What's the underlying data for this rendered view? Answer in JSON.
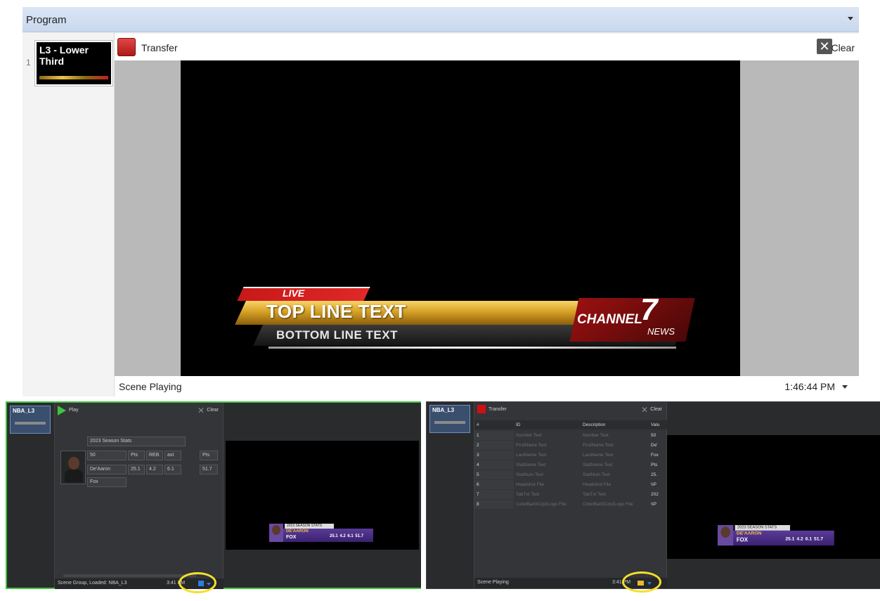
{
  "program": {
    "title": "Program",
    "scene_index": "1",
    "scene_thumb_label": "L3 - Lower Third",
    "transfer_label": "Transfer",
    "clear_label": "Clear",
    "status": "Scene Playing",
    "time": "1:46:44 PM"
  },
  "lower_third": {
    "live": "LIVE",
    "top_line": "TOP LINE TEXT",
    "bottom_line": "BOTTOM LINE TEXT",
    "logo_word": "CHANNEL",
    "logo_number": "7",
    "logo_sub": "NEWS"
  },
  "left_panel": {
    "scene_thumb_label": "NBA_L3",
    "play_label": "Play",
    "clear_label": "Clear",
    "season_field": "2023 Season Stats",
    "number_field": "50",
    "stat_headers": [
      "Pts",
      "REB",
      "ast",
      "Pts"
    ],
    "first_name": "De'Aaron",
    "stat_values": [
      "25.1",
      "4.2",
      "6.1",
      "51.7"
    ],
    "last_name": "Fox",
    "status": "Scene Group, Loaded: NBA_L3",
    "time": "3:41 PM"
  },
  "stat_graphic": {
    "title": "2023 SEASON STATS",
    "first": "DE'AARON",
    "last": "FOX",
    "values": "25.1 4.2 6.1 51.7"
  },
  "right_panel": {
    "scene_thumb_label": "NBA_L3",
    "transfer_label": "Transfer",
    "clear_label": "Clear",
    "table": {
      "headers": [
        "#",
        "ID",
        "Description",
        "Valu"
      ],
      "rows": [
        {
          "num": "1",
          "id": "Number Text",
          "desc": "Number Text",
          "val": "50"
        },
        {
          "num": "2",
          "id": "FirstName Text",
          "desc": "FirstName Text",
          "val": "De'"
        },
        {
          "num": "3",
          "id": "LastName Text",
          "desc": "LastName Text",
          "val": "Fox"
        },
        {
          "num": "4",
          "id": "StatName Text",
          "desc": "StatName Text",
          "val": "Pts"
        },
        {
          "num": "5",
          "id": "StatNum Text",
          "desc": "StatNum Text",
          "val": "25."
        },
        {
          "num": "6",
          "id": "Headshot File",
          "desc": "Headshot File",
          "val": "\\\\P"
        },
        {
          "num": "7",
          "id": "TabTxt Text",
          "desc": "TabTxt Text",
          "val": "202"
        },
        {
          "num": "8",
          "id": "ColorBarGCrp2Logo File",
          "desc": "ColorBarGCrp2Logo File",
          "val": "\\\\P"
        }
      ]
    },
    "status": "Scene Playing",
    "time": "3:41 PM"
  },
  "colors": {
    "accent_green": "#3ec43e",
    "transfer_red": "#d01010",
    "highlight_yellow": "#f3e02a",
    "toggle_blue": "#2c7de0"
  },
  "icons": [
    "program-menu-caret-icon",
    "transfer-icon",
    "clear-icon",
    "time-caret-icon",
    "play-icon",
    "headshot-icon",
    "layout-toggle-icon"
  ]
}
